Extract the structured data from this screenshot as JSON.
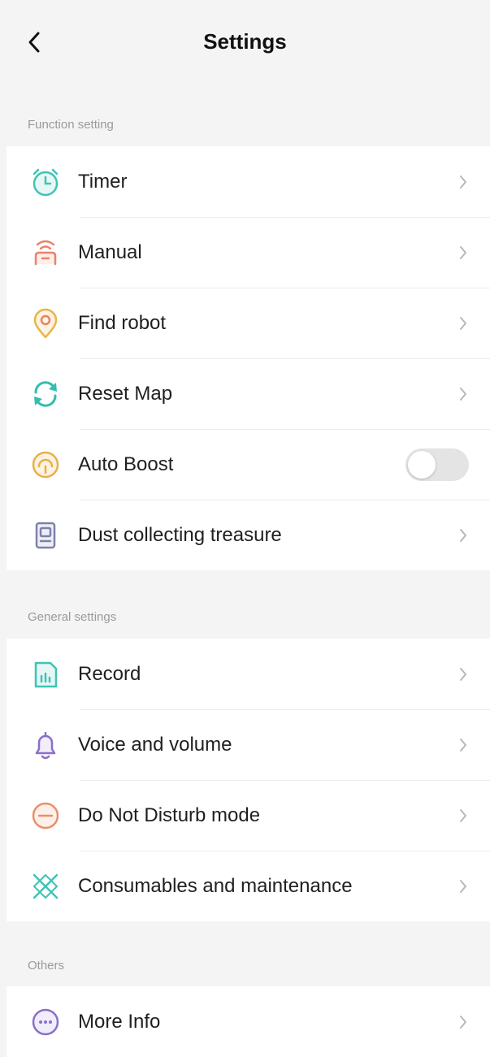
{
  "header": {
    "title": "Settings"
  },
  "sections": {
    "function": {
      "header": "Function setting",
      "items": [
        {
          "label": "Timer",
          "icon": "alarm-clock-icon",
          "color": "#3fc4b5"
        },
        {
          "label": "Manual",
          "icon": "remote-signal-icon",
          "color": "#e8826a"
        },
        {
          "label": "Find robot",
          "icon": "location-pin-icon",
          "color": "#eab44a"
        },
        {
          "label": "Reset Map",
          "icon": "refresh-icon",
          "color": "#33bdb0"
        },
        {
          "label": "Auto Boost",
          "icon": "boost-gauge-icon",
          "color": "#e8b04a",
          "toggle": false
        },
        {
          "label": "Dust collecting treasure",
          "icon": "dust-station-icon",
          "color": "#7d81a8"
        }
      ]
    },
    "general": {
      "header": "General settings",
      "items": [
        {
          "label": "Record",
          "icon": "record-chart-icon",
          "color": "#3fc4b5"
        },
        {
          "label": "Voice and volume",
          "icon": "bell-icon",
          "color": "#8a6fc9"
        },
        {
          "label": "Do Not Disturb mode",
          "icon": "do-not-disturb-icon",
          "color": "#e8906a"
        },
        {
          "label": "Consumables and maintenance",
          "icon": "consumables-icon",
          "color": "#3fc4b5"
        }
      ]
    },
    "others": {
      "header": "Others",
      "items": [
        {
          "label": "More Info",
          "icon": "more-info-icon",
          "color": "#8a6fc9"
        }
      ]
    }
  },
  "colors": {
    "background": "#f4f4f4",
    "row_background": "#ffffff",
    "chevron": "#b8b8b8",
    "section_header": "#9a9a9a",
    "toggle_off": "#e4e4e4",
    "accent": "#1bb4c8"
  }
}
